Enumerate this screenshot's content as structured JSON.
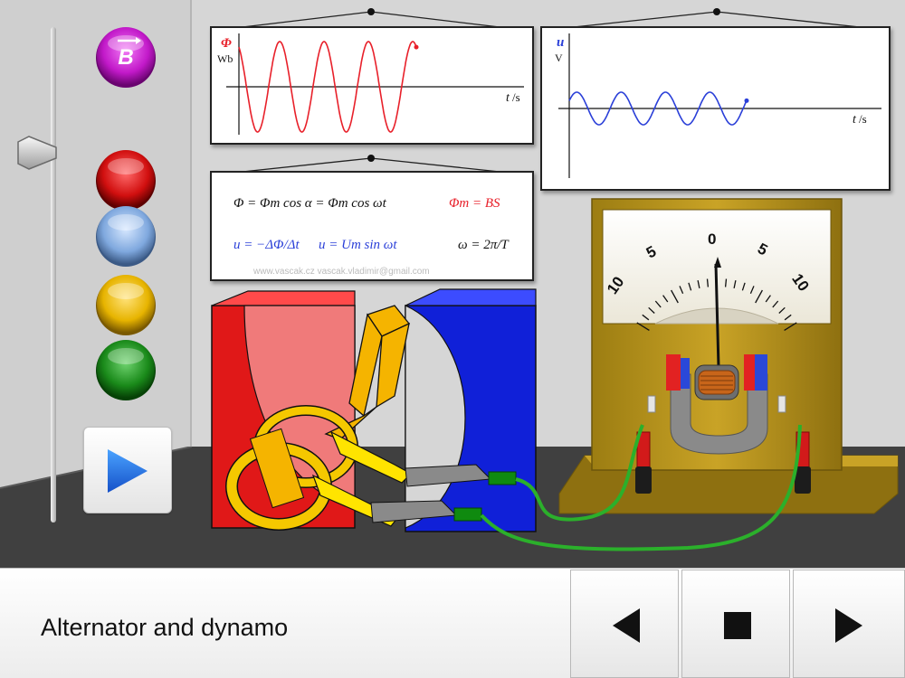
{
  "app": {
    "title": "Alternator and dynamo"
  },
  "flux_graph": {
    "symbol": "Φ",
    "unit": "Wb",
    "axis_symbol": "t",
    "axis_unit": "/s",
    "color": "#e8202a"
  },
  "voltage_graph": {
    "symbol": "u",
    "unit": "V",
    "axis_symbol": "t",
    "axis_unit": "/s",
    "color": "#2a3fd8"
  },
  "formulas": {
    "line1_left": "Φ = Φm cos α = Φm cos ωt",
    "line1_right": "Φm = BS",
    "line2_a": "u = −ΔΦ/Δt",
    "line2_b": "u = Um sin ωt",
    "line2_c": "ω = 2π/T",
    "credit": "www.vascak.cz    vascak.vladimir@gmail.com"
  },
  "meter": {
    "scale_labels": [
      "10",
      "5",
      "0",
      "5",
      "10"
    ],
    "needle_value": 0
  },
  "controls": {
    "field_button_label": "B",
    "color_buttons": [
      "red",
      "blue",
      "yellow",
      "green"
    ],
    "colors": {
      "red": "#d10f0f",
      "blue": "#7fa8de",
      "yellow": "#e7b400",
      "green": "#1a8a1a",
      "magenta": "#c219c9"
    }
  },
  "icons": {
    "play": "play-icon",
    "prev": "chevron-left-icon",
    "stop": "stop-icon",
    "next": "chevron-right-icon"
  }
}
